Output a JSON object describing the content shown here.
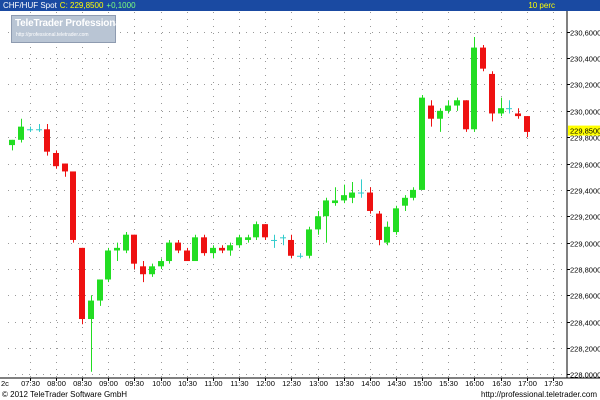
{
  "header": {
    "symbol": "CHF/HUF Spot",
    "price": "C: 229,8500",
    "change": "+0,1000",
    "interval": "10 perc"
  },
  "watermark": {
    "title": "TeleTrader Professional",
    "url": "http://professional.teletrader.com"
  },
  "footer": {
    "copyright": "© 2012 TeleTrader Software GmbH",
    "url": "http://professional.teletrader.com"
  },
  "colors": {
    "up": "#22dd22",
    "down": "#ee1111",
    "doji": "#33cccc",
    "header_bg": "#1a4aa2",
    "last_price_bg": "#ffff00"
  },
  "chart_data": {
    "type": "candlestick",
    "x_ticks": [
      "07:30",
      "08:00",
      "08:30",
      "09:00",
      "09:30",
      "10:00",
      "10:30",
      "11:00",
      "11:30",
      "12:00",
      "12:30",
      "13:00",
      "13:30",
      "14:00",
      "14:30",
      "15:00",
      "15:30",
      "16:00",
      "16:30",
      "17:00",
      "17:30"
    ],
    "x_axis_start_label": "2c",
    "y_ticks": [
      "228,0000",
      "228,2000",
      "228,4000",
      "228,6000",
      "228,8000",
      "229,0000",
      "229,2000",
      "229,4000",
      "229,6000",
      "229,8000",
      "230,0000",
      "230,2000",
      "230,4000",
      "230,6000"
    ],
    "ylim": [
      227.98,
      230.75
    ],
    "xlim": [
      "07:05",
      "17:45"
    ],
    "last_price": "229,8500",
    "last_price_value": 229.85,
    "grid": true,
    "candles": [
      {
        "t": "07:10",
        "o": 229.74,
        "h": 229.78,
        "l": 229.7,
        "c": 229.78
      },
      {
        "t": "07:20",
        "o": 229.78,
        "h": 229.94,
        "l": 229.76,
        "c": 229.88
      },
      {
        "t": "07:30",
        "o": 229.86,
        "h": 229.88,
        "l": 229.84,
        "c": 229.86
      },
      {
        "t": "07:40",
        "o": 229.86,
        "h": 229.9,
        "l": 229.84,
        "c": 229.86
      },
      {
        "t": "07:50",
        "o": 229.86,
        "h": 229.9,
        "l": 229.66,
        "c": 229.69
      },
      {
        "t": "08:00",
        "o": 229.68,
        "h": 229.7,
        "l": 229.56,
        "c": 229.58
      },
      {
        "t": "08:10",
        "o": 229.6,
        "h": 229.6,
        "l": 229.5,
        "c": 229.54
      },
      {
        "t": "08:20",
        "o": 229.54,
        "h": 229.54,
        "l": 229.0,
        "c": 229.02
      },
      {
        "t": "08:30",
        "o": 228.96,
        "h": 228.96,
        "l": 228.38,
        "c": 228.42
      },
      {
        "t": "08:40",
        "o": 228.42,
        "h": 228.6,
        "l": 228.02,
        "c": 228.56
      },
      {
        "t": "08:50",
        "o": 228.56,
        "h": 228.72,
        "l": 228.52,
        "c": 228.72
      },
      {
        "t": "09:00",
        "o": 228.72,
        "h": 228.96,
        "l": 228.7,
        "c": 228.94
      },
      {
        "t": "09:10",
        "o": 228.94,
        "h": 229.0,
        "l": 228.86,
        "c": 228.96
      },
      {
        "t": "09:20",
        "o": 228.94,
        "h": 229.08,
        "l": 228.92,
        "c": 229.06
      },
      {
        "t": "09:30",
        "o": 229.06,
        "h": 229.06,
        "l": 228.8,
        "c": 228.84
      },
      {
        "t": "09:40",
        "o": 228.82,
        "h": 228.86,
        "l": 228.7,
        "c": 228.76
      },
      {
        "t": "09:50",
        "o": 228.76,
        "h": 228.84,
        "l": 228.74,
        "c": 228.82
      },
      {
        "t": "10:00",
        "o": 228.82,
        "h": 228.88,
        "l": 228.8,
        "c": 228.86
      },
      {
        "t": "10:10",
        "o": 228.86,
        "h": 229.02,
        "l": 228.84,
        "c": 229.0
      },
      {
        "t": "10:20",
        "o": 229.0,
        "h": 229.02,
        "l": 228.92,
        "c": 228.94
      },
      {
        "t": "10:30",
        "o": 228.94,
        "h": 228.96,
        "l": 228.86,
        "c": 228.86
      },
      {
        "t": "10:40",
        "o": 228.86,
        "h": 229.06,
        "l": 228.86,
        "c": 229.04
      },
      {
        "t": "10:50",
        "o": 229.04,
        "h": 229.06,
        "l": 228.9,
        "c": 228.92
      },
      {
        "t": "11:00",
        "o": 228.92,
        "h": 228.98,
        "l": 228.88,
        "c": 228.96
      },
      {
        "t": "11:10",
        "o": 228.96,
        "h": 228.98,
        "l": 228.92,
        "c": 228.94
      },
      {
        "t": "11:20",
        "o": 228.94,
        "h": 229.0,
        "l": 228.9,
        "c": 228.98
      },
      {
        "t": "11:30",
        "o": 228.98,
        "h": 229.06,
        "l": 228.96,
        "c": 229.04
      },
      {
        "t": "11:40",
        "o": 229.02,
        "h": 229.06,
        "l": 229.0,
        "c": 229.04
      },
      {
        "t": "11:50",
        "o": 229.04,
        "h": 229.16,
        "l": 229.02,
        "c": 229.14
      },
      {
        "t": "12:00",
        "o": 229.14,
        "h": 229.14,
        "l": 229.02,
        "c": 229.04
      },
      {
        "t": "12:10",
        "o": 229.02,
        "h": 229.06,
        "l": 228.96,
        "c": 229.02
      },
      {
        "t": "12:20",
        "o": 229.04,
        "h": 229.06,
        "l": 228.98,
        "c": 229.04
      },
      {
        "t": "12:30",
        "o": 229.02,
        "h": 229.06,
        "l": 228.88,
        "c": 228.9
      },
      {
        "t": "12:40",
        "o": 228.9,
        "h": 228.92,
        "l": 228.88,
        "c": 228.9
      },
      {
        "t": "12:50",
        "o": 228.9,
        "h": 229.12,
        "l": 228.88,
        "c": 229.1
      },
      {
        "t": "13:00",
        "o": 229.1,
        "h": 229.24,
        "l": 229.06,
        "c": 229.2
      },
      {
        "t": "13:10",
        "o": 229.2,
        "h": 229.34,
        "l": 229.0,
        "c": 229.32
      },
      {
        "t": "13:20",
        "o": 229.3,
        "h": 229.42,
        "l": 229.28,
        "c": 229.32
      },
      {
        "t": "13:30",
        "o": 229.32,
        "h": 229.44,
        "l": 229.3,
        "c": 229.36
      },
      {
        "t": "13:40",
        "o": 229.34,
        "h": 229.46,
        "l": 229.3,
        "c": 229.38
      },
      {
        "t": "13:50",
        "o": 229.38,
        "h": 229.48,
        "l": 229.34,
        "c": 229.38
      },
      {
        "t": "14:00",
        "o": 229.38,
        "h": 229.42,
        "l": 229.22,
        "c": 229.24
      },
      {
        "t": "14:10",
        "o": 229.22,
        "h": 229.24,
        "l": 228.98,
        "c": 229.02
      },
      {
        "t": "14:20",
        "o": 229.0,
        "h": 229.16,
        "l": 228.98,
        "c": 229.12
      },
      {
        "t": "14:30",
        "o": 229.08,
        "h": 229.28,
        "l": 229.06,
        "c": 229.26
      },
      {
        "t": "14:40",
        "o": 229.28,
        "h": 229.36,
        "l": 229.24,
        "c": 229.34
      },
      {
        "t": "14:50",
        "o": 229.34,
        "h": 229.42,
        "l": 229.32,
        "c": 229.4
      },
      {
        "t": "15:00",
        "o": 229.4,
        "h": 230.12,
        "l": 229.4,
        "c": 230.1
      },
      {
        "t": "15:10",
        "o": 230.04,
        "h": 230.08,
        "l": 229.88,
        "c": 229.94
      },
      {
        "t": "15:20",
        "o": 229.94,
        "h": 230.02,
        "l": 229.84,
        "c": 230.0
      },
      {
        "t": "15:30",
        "o": 230.0,
        "h": 230.08,
        "l": 229.98,
        "c": 230.04
      },
      {
        "t": "15:40",
        "o": 230.04,
        "h": 230.1,
        "l": 230.0,
        "c": 230.08
      },
      {
        "t": "15:50",
        "o": 230.08,
        "h": 230.08,
        "l": 229.84,
        "c": 229.86
      },
      {
        "t": "16:00",
        "o": 229.86,
        "h": 230.56,
        "l": 229.84,
        "c": 230.48
      },
      {
        "t": "16:10",
        "o": 230.48,
        "h": 230.5,
        "l": 230.3,
        "c": 230.32
      },
      {
        "t": "16:20",
        "o": 230.28,
        "h": 230.3,
        "l": 229.92,
        "c": 229.98
      },
      {
        "t": "16:30",
        "o": 229.98,
        "h": 230.1,
        "l": 229.96,
        "c": 230.02
      },
      {
        "t": "16:40",
        "o": 230.02,
        "h": 230.08,
        "l": 229.98,
        "c": 230.02
      },
      {
        "t": "16:50",
        "o": 229.98,
        "h": 230.02,
        "l": 229.94,
        "c": 229.96
      },
      {
        "t": "17:00",
        "o": 229.96,
        "h": 229.96,
        "l": 229.8,
        "c": 229.84
      }
    ]
  }
}
